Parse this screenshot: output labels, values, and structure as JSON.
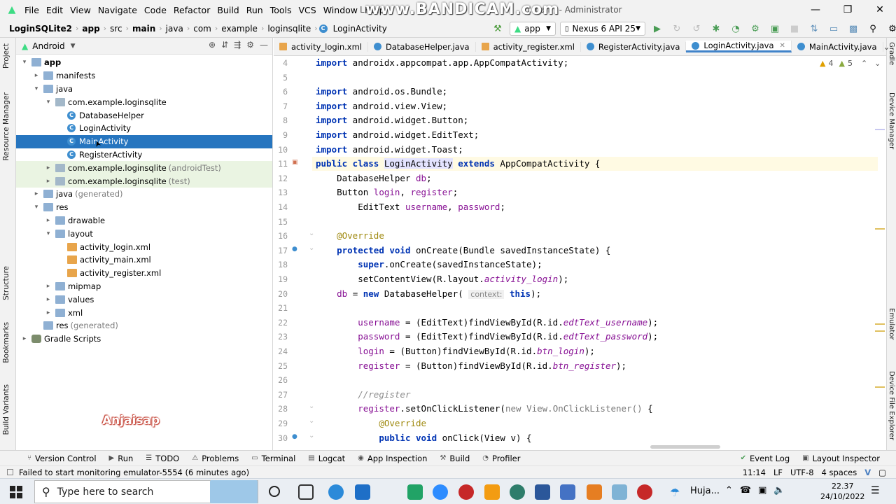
{
  "menubar": {
    "items": [
      "File",
      "Edit",
      "View",
      "Navigate",
      "Code",
      "Refactor",
      "Build",
      "Run",
      "Tools",
      "VCS",
      "Window",
      "Help"
    ],
    "title_prefix": "L",
    "title_suffix": "p.main] - Administrator",
    "watermark": "www.BANDICAM.com"
  },
  "navbar": {
    "breadcrumbs": [
      "LoginSQLite2",
      "app",
      "src",
      "main",
      "java",
      "com",
      "example",
      "loginsqlite",
      "LoginActivity"
    ],
    "run_config": "app",
    "device": "Nexus 6 API 25"
  },
  "left_tool_tabs": [
    "Project",
    "Resource Manager",
    "Structure",
    "Bookmarks",
    "Build Variants"
  ],
  "right_tool_tabs": [
    "Gradle",
    "Device Manager",
    "Emulator",
    "Device File Explorer"
  ],
  "project": {
    "view_mode": "Android",
    "tree": [
      {
        "label": "app",
        "bold": true,
        "depth": 0,
        "arrow": "▾",
        "icon": "folder"
      },
      {
        "label": "manifests",
        "depth": 1,
        "arrow": "▸",
        "icon": "folder"
      },
      {
        "label": "java",
        "depth": 1,
        "arrow": "▾",
        "icon": "folder"
      },
      {
        "label": "com.example.loginsqlite",
        "depth": 2,
        "arrow": "▾",
        "icon": "pkg"
      },
      {
        "label": "DatabaseHelper",
        "depth": 3,
        "arrow": "",
        "icon": "class"
      },
      {
        "label": "LoginActivity",
        "depth": 3,
        "arrow": "",
        "icon": "class"
      },
      {
        "label": "MainActivity",
        "depth": 3,
        "arrow": "",
        "icon": "class",
        "selected": true
      },
      {
        "label": "RegisterActivity",
        "depth": 3,
        "arrow": "",
        "icon": "class"
      },
      {
        "label": "com.example.loginsqlite",
        "note": "(androidTest)",
        "depth": 2,
        "arrow": "▸",
        "icon": "pkg",
        "highlight": true
      },
      {
        "label": "com.example.loginsqlite",
        "note": "(test)",
        "depth": 2,
        "arrow": "▸",
        "icon": "pkg",
        "highlight": true
      },
      {
        "label": "java",
        "note": "(generated)",
        "depth": 1,
        "arrow": "▸",
        "icon": "folder"
      },
      {
        "label": "res",
        "depth": 1,
        "arrow": "▾",
        "icon": "folder"
      },
      {
        "label": "drawable",
        "depth": 2,
        "arrow": "▸",
        "icon": "folder"
      },
      {
        "label": "layout",
        "depth": 2,
        "arrow": "▾",
        "icon": "folder"
      },
      {
        "label": "activity_login.xml",
        "depth": 3,
        "arrow": "",
        "icon": "xml"
      },
      {
        "label": "activity_main.xml",
        "depth": 3,
        "arrow": "",
        "icon": "xml"
      },
      {
        "label": "activity_register.xml",
        "depth": 3,
        "arrow": "",
        "icon": "xml"
      },
      {
        "label": "mipmap",
        "depth": 2,
        "arrow": "▸",
        "icon": "folder"
      },
      {
        "label": "values",
        "depth": 2,
        "arrow": "▸",
        "icon": "folder"
      },
      {
        "label": "xml",
        "depth": 2,
        "arrow": "▸",
        "icon": "folder"
      },
      {
        "label": "res",
        "note": "(generated)",
        "depth": 1,
        "arrow": "",
        "icon": "folder"
      },
      {
        "label": "Gradle Scripts",
        "depth": 0,
        "arrow": "▸",
        "icon": "gradle"
      }
    ],
    "watermark": "Anjaisap"
  },
  "editor_tabs": [
    {
      "label": "activity_login.xml",
      "icon": "xml"
    },
    {
      "label": "DatabaseHelper.java",
      "icon": "class"
    },
    {
      "label": "activity_register.xml",
      "icon": "xml"
    },
    {
      "label": "RegisterActivity.java",
      "icon": "class"
    },
    {
      "label": "LoginActivity.java",
      "icon": "class",
      "active": true
    },
    {
      "label": "MainActivity.java",
      "icon": "class"
    }
  ],
  "editor": {
    "warnings": "4",
    "weak_warnings": "5",
    "lines": [
      {
        "n": "4",
        "html": "<span class=\"kw\">import</span> androidx.appcompat.app.AppCompatActivity;"
      },
      {
        "n": "5",
        "html": ""
      },
      {
        "n": "6",
        "html": "<span class=\"kw\">import</span> android.os.Bundle;"
      },
      {
        "n": "7",
        "html": "<span class=\"kw\">import</span> android.view.View;"
      },
      {
        "n": "8",
        "html": "<span class=\"kw\">import</span> android.widget.Button;"
      },
      {
        "n": "9",
        "html": "<span class=\"kw\">import</span> android.widget.EditText;"
      },
      {
        "n": "10",
        "html": "<span class=\"kw\">import</span> android.widget.Toast;"
      },
      {
        "n": "11",
        "html": "<span class=\"kw\">public class</span> <span class=\"hlsym\">LoginActivity</span> <span class=\"kw\">extends</span> AppCompatActivity {",
        "current": true
      },
      {
        "n": "12",
        "html": "    DatabaseHelper <span class=\"fld\">db</span>;"
      },
      {
        "n": "13",
        "html": "    Button <span class=\"fld\">login</span>, <span class=\"fld\">register</span>;"
      },
      {
        "n": "14",
        "html": "        EditText <span class=\"fld\">username</span>, <span class=\"fld\">password</span>;"
      },
      {
        "n": "15",
        "html": ""
      },
      {
        "n": "16",
        "html": "    <span class=\"ann\">@Override</span>"
      },
      {
        "n": "17",
        "html": "    <span class=\"kw\">protected void</span> onCreate(Bundle savedInstanceState) {"
      },
      {
        "n": "18",
        "html": "        <span class=\"kw\">super</span>.onCreate(savedInstanceState);"
      },
      {
        "n": "19",
        "html": "        setContentView(R.layout.<span class=\"fld it\">activity_login</span>);"
      },
      {
        "n": "20",
        "html": "    <span class=\"fld\">db</span> = <span class=\"kw\">new</span> DatabaseHelper( <span class=\"hint\">context:</span> <span class=\"kw\">this</span>);"
      },
      {
        "n": "21",
        "html": ""
      },
      {
        "n": "22",
        "html": "        <span class=\"fld\">username</span> = (EditText)findViewById(R.id.<span class=\"fld it\">edtText_username</span>);"
      },
      {
        "n": "23",
        "html": "        <span class=\"fld\">password</span> = (EditText)findViewById(R.id.<span class=\"fld it\">edtText_password</span>);"
      },
      {
        "n": "24",
        "html": "        <span class=\"fld\">login</span> = (Button)findViewById(R.id.<span class=\"fld it\">btn_login</span>);"
      },
      {
        "n": "25",
        "html": "        <span class=\"fld\">register</span> = (Button)findViewById(R.id.<span class=\"fld it\">btn_register</span>);"
      },
      {
        "n": "26",
        "html": ""
      },
      {
        "n": "27",
        "html": "        <span class=\"cmt\">//register</span>"
      },
      {
        "n": "28",
        "html": "        <span class=\"fld\">register</span>.setOnClickListener(<span class=\"kw\" style=\"font-weight:normal;color:#777\">new</span> <span style=\"color:#777\">View.OnClickListener() </span>{"
      },
      {
        "n": "29",
        "html": "            <span class=\"ann\">@Override</span>"
      },
      {
        "n": "30",
        "html": "            <span class=\"kw\">public void</span> onClick(View v) {"
      }
    ]
  },
  "bottom_tools": [
    "Version Control",
    "Run",
    "TODO",
    "Problems",
    "Terminal",
    "Logcat",
    "App Inspection",
    "Build",
    "Profiler"
  ],
  "bottom_tools_right": [
    "Event Log",
    "Layout Inspector"
  ],
  "status": {
    "message": "Failed to start monitoring emulator-5554 (6 minutes ago)",
    "position": "11:14",
    "line_sep": "LF",
    "encoding": "UTF-8",
    "indent": "4 spaces"
  },
  "taskbar": {
    "search_placeholder": "Type here to search",
    "weather": "Huja...",
    "time": "22.37",
    "date": "24/10/2022"
  }
}
